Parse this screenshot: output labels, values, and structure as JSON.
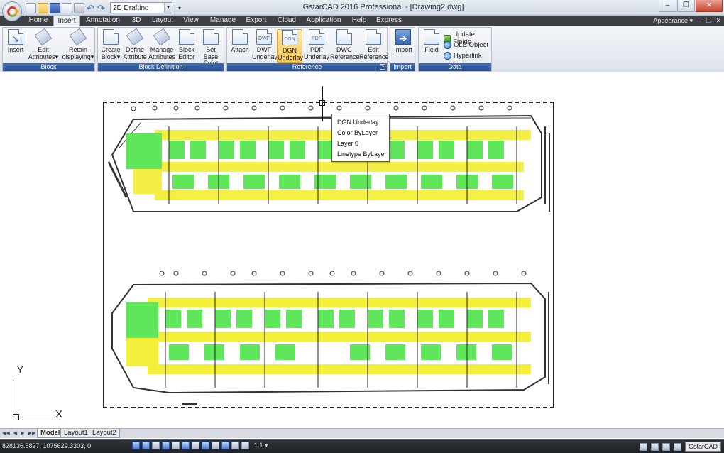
{
  "app": {
    "window_title": "GstarCAD 2016 Professional - [Drawing2.dwg]",
    "workspace": "2D Drafting"
  },
  "ribbon_tabs": [
    "Home",
    "Insert",
    "Annotation",
    "3D",
    "Layout",
    "View",
    "Manage",
    "Export",
    "Cloud",
    "Application",
    "Help",
    "Express"
  ],
  "active_tab": "Insert",
  "appearance_label": "Appearance",
  "panels": {
    "block": {
      "title": "Block",
      "buttons": [
        {
          "line1": "Insert",
          "line2": ""
        },
        {
          "line1": "Edit",
          "line2": "Attributes"
        },
        {
          "line1": "Retain",
          "line2": "displaying"
        }
      ]
    },
    "block_definition": {
      "title": "Block Definition",
      "buttons": [
        {
          "line1": "Create",
          "line2": "Block"
        },
        {
          "line1": "Define",
          "line2": "Attribute"
        },
        {
          "line1": "Manage",
          "line2": "Attributes"
        },
        {
          "line1": "Block",
          "line2": "Editor"
        },
        {
          "line1": "Set Base",
          "line2": "Point"
        }
      ]
    },
    "reference": {
      "title": "Reference",
      "buttons": [
        {
          "line1": "Attach",
          "line2": ""
        },
        {
          "line1": "DWF",
          "line2": "Underlay",
          "icon_text": "DWF"
        },
        {
          "line1": "DGN",
          "line2": "Underlay",
          "icon_text": "DGN"
        },
        {
          "line1": "PDF",
          "line2": "Underlay",
          "icon_text": "PDF"
        },
        {
          "line1": "DWG",
          "line2": "Reference"
        },
        {
          "line1": "Edit",
          "line2": "Reference"
        }
      ]
    },
    "import": {
      "title": "Import",
      "buttons": [
        {
          "line1": "Import",
          "line2": ""
        }
      ]
    },
    "data": {
      "title": "Data",
      "field_label": "Field",
      "items": [
        "Update Fields",
        "OLE Object",
        "Hyperlink"
      ]
    }
  },
  "tooltip": {
    "title": "DGN Underlay",
    "color": "Color  ByLayer",
    "layer": "Layer  0",
    "linetype": "Linetype  ByLayer"
  },
  "ucs": {
    "x": "X",
    "y": "Y"
  },
  "layout_tabs": [
    "Model",
    "Layout1",
    "Layout2"
  ],
  "active_layout": "Model",
  "status": {
    "coordinates": "828136.5827, 1075629.3303, 0",
    "annotation_scale": "1:1",
    "brand": "GstarCAD"
  },
  "colors": {
    "ribbon_blue": "#2a4f8f",
    "plan_yellow": "#f3ef3a",
    "plan_green": "#5fe65a",
    "tab_bar": "#3c3f44"
  }
}
